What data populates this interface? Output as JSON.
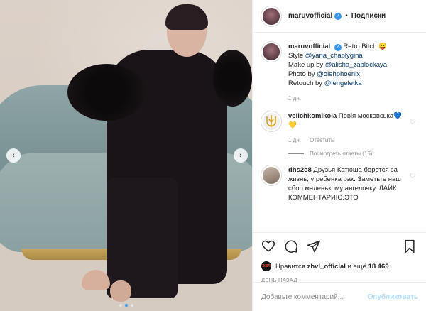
{
  "post": {
    "username": "maruvofficial",
    "follow_label": "Подписки",
    "separator": "•",
    "caption_text": "Retro Bitch 😛",
    "credits": [
      {
        "label": "Style ",
        "handle": "@yana_chaplygina"
      },
      {
        "label": "Make up by ",
        "handle": "@alisha_zablockaya"
      },
      {
        "label": "Photo by ",
        "handle": "@olehphoenix"
      },
      {
        "label": "Retouch by ",
        "handle": "@lengeletka"
      }
    ],
    "caption_time": "1 дн."
  },
  "comments": [
    {
      "username": "velichkomikola",
      "text": "Повія московська💙💛",
      "time": "1 дн.",
      "reply_label": "Ответить",
      "replies_label": "Посмотреть ответы (15)"
    },
    {
      "username": "dhs2e8",
      "text": "Друзья Катюша борется за жизнь, у ребенка рак. Заметьте наш сбор маленькому ангелочку. ЛАЙК КОММЕНТАРИЮ.ЭТО"
    }
  ],
  "likes": {
    "text_prefix": "Нравится ",
    "user": "zhvl_official",
    "text_suffix": " и ещё ",
    "count": "18 469",
    "avatar_text": "ЖВЛ"
  },
  "date_label": "ДЕНЬ НАЗАД",
  "composer": {
    "placeholder": "Добавьте комментарий...",
    "publish_label": "Опубликовать"
  },
  "media": {
    "arrow_left": "‹",
    "arrow_right": "›",
    "dot_count": 3,
    "active_dot": 1
  },
  "colors": {
    "link": "#00376b",
    "accent": "#3897f0",
    "muted": "#8e8e8e",
    "publish_disabled": "#b2dffc"
  }
}
